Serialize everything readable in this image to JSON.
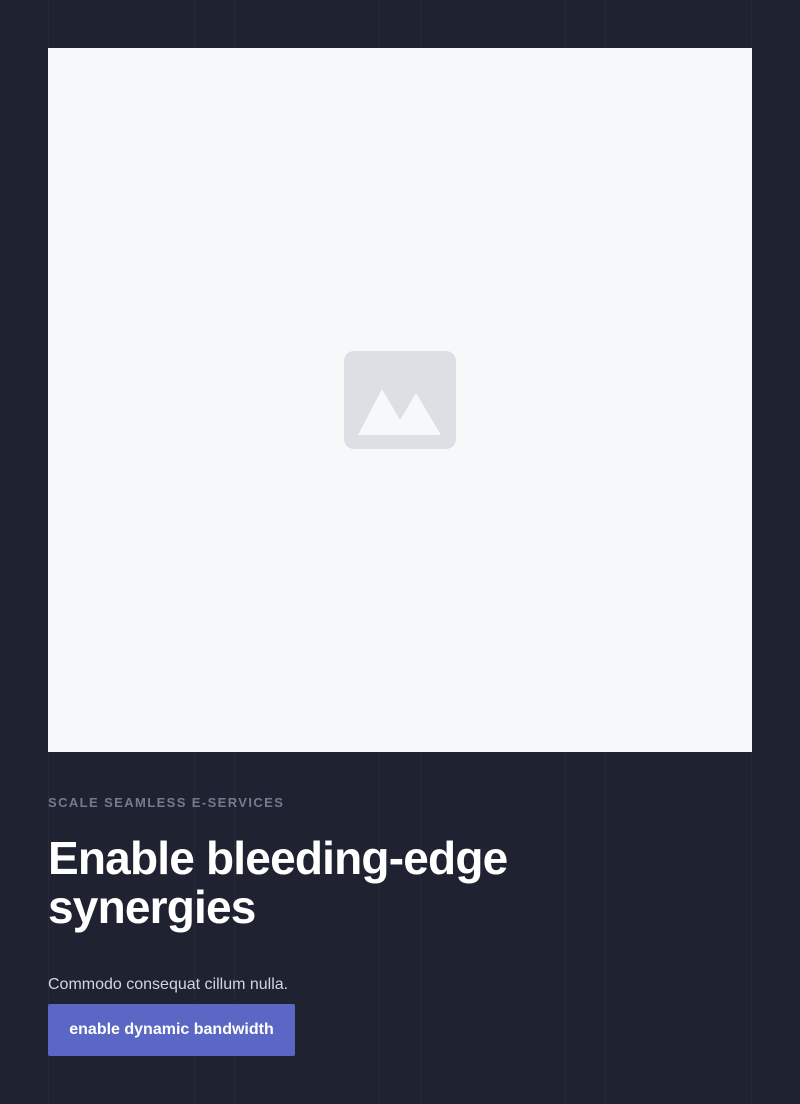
{
  "hero": {
    "image_icon": "image-placeholder-icon"
  },
  "content": {
    "eyebrow": "SCALE SEAMLESS E-SERVICES",
    "headline": "Enable bleeding-edge synergies",
    "description": "Commodo consequat cillum nulla.",
    "cta_label": "enable dynamic bandwidth"
  },
  "colors": {
    "background": "#1e2231",
    "image_background": "#f7f8fa",
    "icon": "#dcdfe3",
    "eyebrow": "#737b8f",
    "headline": "#ffffff",
    "description": "#d3d6de",
    "cta_background": "#5a67c4",
    "cta_text": "#ffffff"
  }
}
